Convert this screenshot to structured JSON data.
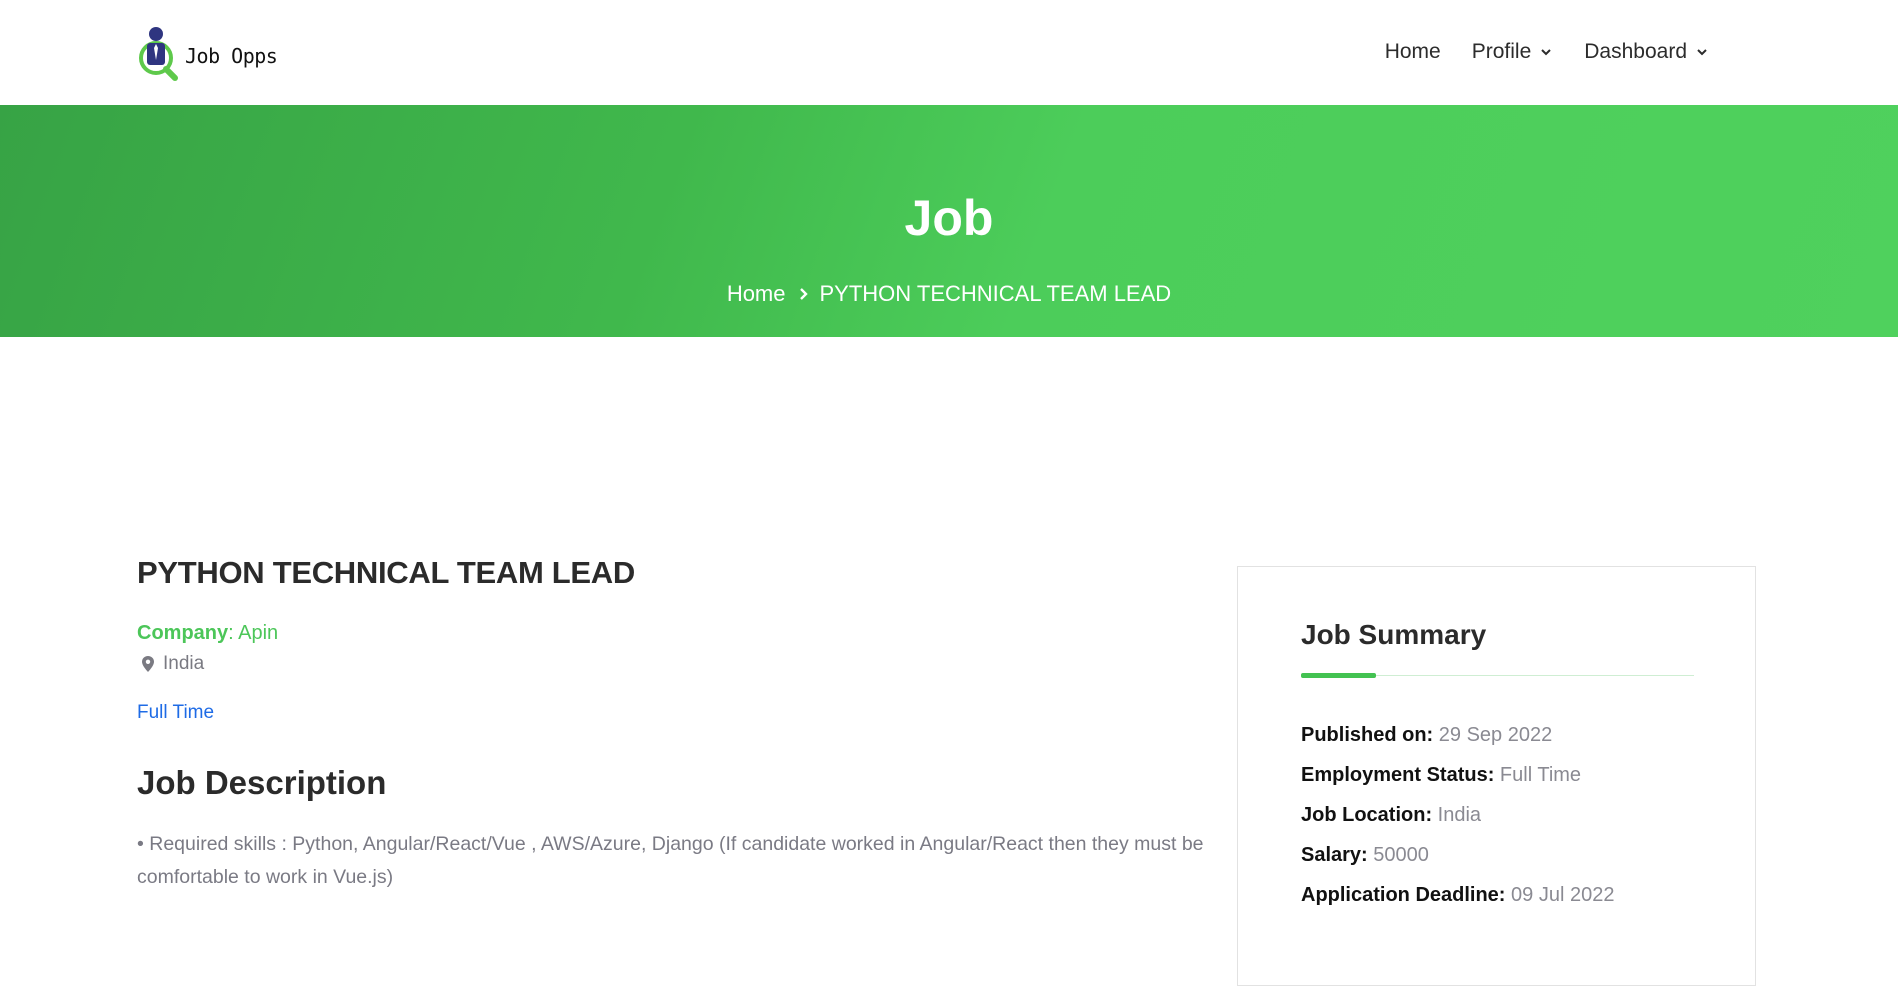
{
  "brand": {
    "name": "Job Opps",
    "logo_icon": "job-search-person-icon",
    "accent_color": "#4cc659"
  },
  "nav": {
    "items": [
      {
        "label": "Home",
        "has_dropdown": false
      },
      {
        "label": "Profile",
        "has_dropdown": true
      },
      {
        "label": "Dashboard",
        "has_dropdown": true
      }
    ]
  },
  "hero": {
    "title": "Job",
    "breadcrumb": {
      "home": "Home",
      "current": "PYTHON TECHNICAL TEAM LEAD"
    }
  },
  "job": {
    "title": "PYTHON TECHNICAL TEAM LEAD",
    "company_label": "Company",
    "company_sep": ": ",
    "company_name": "Apin",
    "location": "India",
    "job_type": "Full Time",
    "description_heading": "Job Description",
    "description": "• Required skills : Python, Angular/React/Vue , AWS/Azure, Django (If candidate worked in Angular/React then they must be comfortable to work in Vue.js)"
  },
  "summary": {
    "title": "Job Summary",
    "items": [
      {
        "label": "Published on:",
        "value": "29 Sep 2022"
      },
      {
        "label": "Employment Status:",
        "value": "Full Time"
      },
      {
        "label": "Job Location:",
        "value": "India"
      },
      {
        "label": "Salary:",
        "value": "50000"
      },
      {
        "label": "Application Deadline:",
        "value": "09 Jul 2022"
      }
    ]
  }
}
